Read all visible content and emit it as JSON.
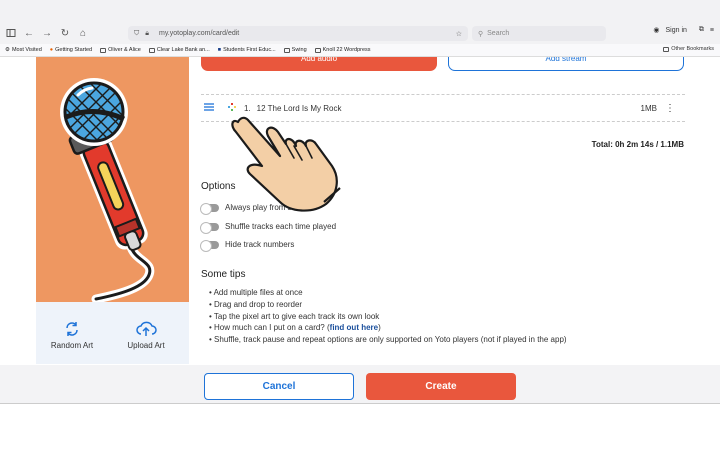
{
  "browser": {
    "url": "my.yotoplay.com/card/edit",
    "search_placeholder": "Search",
    "sign_in_label": "Sign in",
    "bookmarks": [
      "Most Visited",
      "Getting Started",
      "Oliver & Alice",
      "Clear Lake Bank an...",
      "Students First Educ...",
      "Swing",
      "Knoll 22 Wordpress"
    ],
    "other_bookmarks": "Other Bookmarks"
  },
  "card": {
    "add_audio_label": "Add audio",
    "add_stream_label": "Add stream",
    "tracks": [
      {
        "number": "1.",
        "title": "12 The Lord Is My Rock",
        "size": "1MB"
      }
    ],
    "total": "Total: 0h 2m 14s / 1.1MB"
  },
  "art_tools": {
    "random_label": "Random Art",
    "upload_label": "Upload Art"
  },
  "options": {
    "heading": "Options",
    "items": [
      "Always play from sta",
      "Shuffle tracks each time played",
      "Hide track numbers"
    ]
  },
  "tips": {
    "heading": "Some tips",
    "items": [
      "Add multiple files at once",
      "Drag and drop to reorder",
      "Tap the pixel art to give each track its own look",
      "Shuffle, track pause and repeat options are only supported on Yoto players (not if played in the app)"
    ],
    "capacity_prefix": "How much can I put on a card? (",
    "capacity_link": "find out here",
    "capacity_suffix": ")"
  },
  "footer": {
    "cancel_label": "Cancel",
    "create_label": "Create"
  },
  "colors": {
    "accent_orange": "#e9573d",
    "accent_blue": "#1e73d8",
    "art_background": "#ee9761"
  }
}
